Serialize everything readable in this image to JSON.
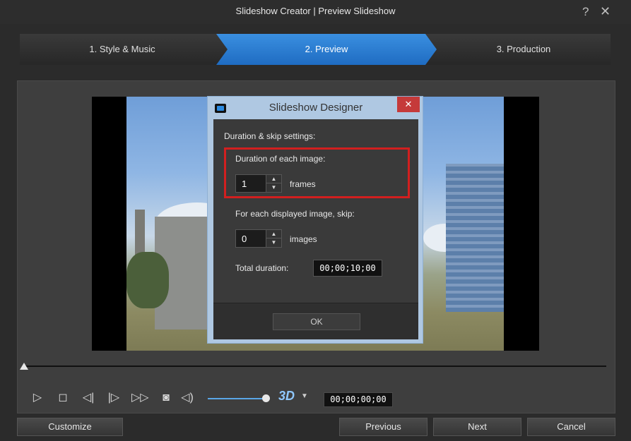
{
  "window": {
    "title": "Slideshow Creator | Preview Slideshow",
    "help": "?",
    "close": "✕"
  },
  "steps": [
    {
      "label": "1. Style & Music"
    },
    {
      "label": "2. Preview"
    },
    {
      "label": "3. Production"
    }
  ],
  "dialog": {
    "title": "Slideshow Designer",
    "close": "✕",
    "section_label": "Duration & skip settings:",
    "duration_label": "Duration of each image:",
    "duration_value": "1",
    "duration_unit": "frames",
    "skip_label": "For each displayed image, skip:",
    "skip_value": "0",
    "skip_unit": "images",
    "total_label": "Total duration:",
    "total_value": "00;00;10;00",
    "ok_label": "OK"
  },
  "player": {
    "timecode": "00;00;00;00",
    "label_3d": "3D",
    "volume_fraction": 0.93
  },
  "buttons": {
    "customize": "Customize",
    "previous": "Previous",
    "next": "Next",
    "cancel": "Cancel"
  }
}
